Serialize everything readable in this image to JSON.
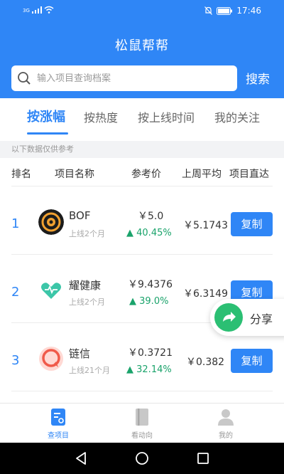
{
  "status_bar": {
    "network_label": "3G",
    "time": "17:46"
  },
  "app_title": "松鼠帮帮",
  "search": {
    "placeholder": "输入项目查询档案",
    "button_label": "搜索"
  },
  "tabs": [
    {
      "label": "按涨幅",
      "active": true
    },
    {
      "label": "按热度",
      "active": false
    },
    {
      "label": "按上线时间",
      "active": false
    },
    {
      "label": "我的关注",
      "active": false
    }
  ],
  "notice": "以下数据仅供参考",
  "columns": {
    "rank": "排名",
    "name": "项目名称",
    "price": "参考价",
    "avg": "上周平均",
    "link": "项目直达"
  },
  "rows": [
    {
      "rank": "1",
      "name": "BOF",
      "online": "上线2个月",
      "price": "￥5.0",
      "change": "40.45%",
      "avg": "￥5.1743",
      "action": "复制",
      "logo_icon": "bof-logo-icon"
    },
    {
      "rank": "2",
      "name": "耀健康",
      "online": "上线2个月",
      "price": "￥9.4376",
      "change": "39.0%",
      "avg": "￥6.3149",
      "action": "复制",
      "logo_icon": "heart-logo-icon"
    },
    {
      "rank": "3",
      "name": "链信",
      "online": "上线21个月",
      "price": "￥0.3721",
      "change": "32.14%",
      "avg": "￥0.382",
      "action": "复制",
      "logo_icon": "chat-logo-icon"
    }
  ],
  "share": {
    "label": "分享",
    "icon": "share-arrow-icon"
  },
  "bottom_nav": [
    {
      "label": "查项目",
      "icon": "document-icon",
      "active": true
    },
    {
      "label": "看动向",
      "icon": "book-icon",
      "active": false
    },
    {
      "label": "我的",
      "icon": "user-icon",
      "active": false
    }
  ],
  "colors": {
    "primary": "#2f86f6",
    "rise": "#1aa36b",
    "share_green": "#2bbf73"
  }
}
